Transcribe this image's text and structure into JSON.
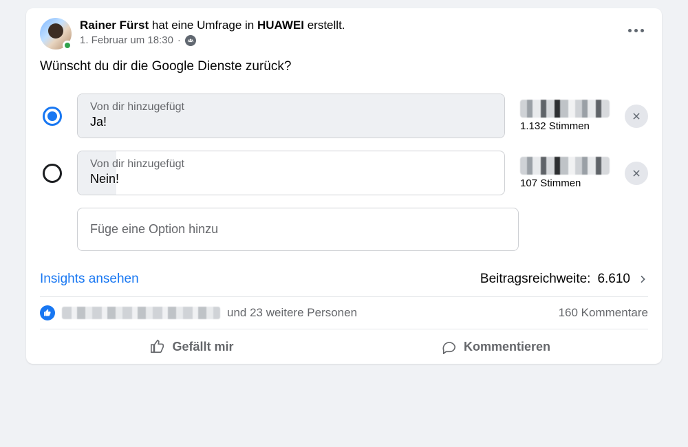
{
  "header": {
    "author": "Rainer Fürst",
    "verb": "hat eine Umfrage in",
    "group": "HUAWEI",
    "tail": "erstellt.",
    "timestamp": "1. Februar um 18:30",
    "dot": "·",
    "audience_icon": "group-icon"
  },
  "question": "Wünscht du dir die Google Dienste zurück?",
  "poll": {
    "options": [
      {
        "added_by": "Von dir hinzugefügt",
        "label": "Ja!",
        "votes_label": "1.132 Stimmen",
        "selected": true,
        "fill_pct": 100
      },
      {
        "added_by": "Von dir hinzugefügt",
        "label": "Nein!",
        "votes_label": "107 Stimmen",
        "selected": false,
        "fill_pct": 9
      }
    ],
    "add_placeholder": "Füge eine Option hinzu"
  },
  "insights": {
    "link": "Insights ansehen",
    "reach_label": "Beitragsreichweite:",
    "reach_value": "6.610"
  },
  "reactions": {
    "names_redacted": true,
    "others_text": "und 23 weitere Personen",
    "comments_text": "160 Kommentare"
  },
  "actions": {
    "like": "Gefällt mir",
    "comment": "Kommentieren"
  }
}
